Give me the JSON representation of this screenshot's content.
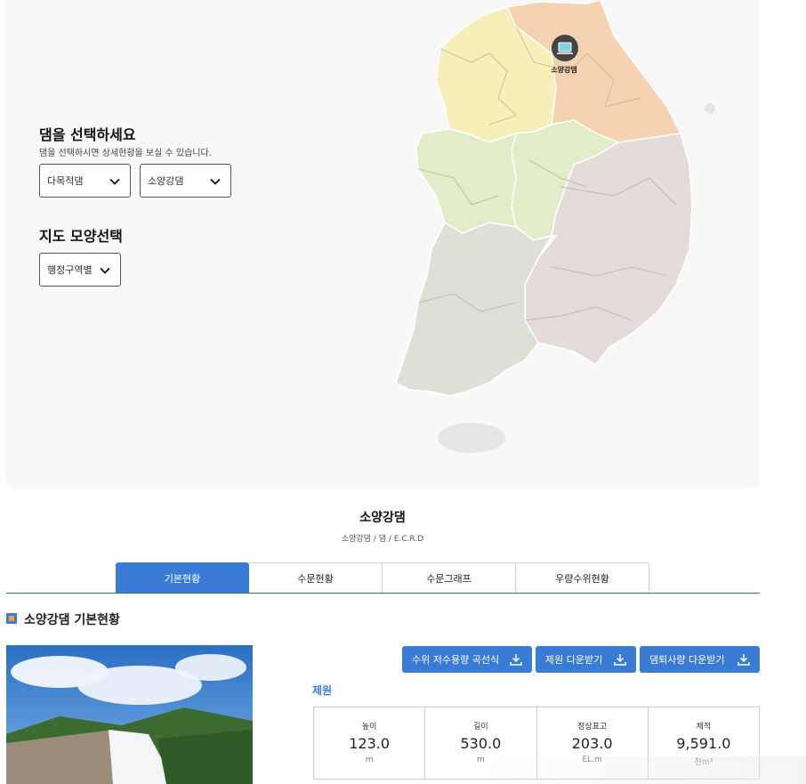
{
  "selector": {
    "title": "댐을 선택하세요",
    "subtitle": "댐을 선택하시면 상세현황을 보실 수 있습니다.",
    "dam_type": "다목적댐",
    "dam_name": "소양강댐"
  },
  "map_shape": {
    "title": "지도 모양선택",
    "value": "행정구역별"
  },
  "map": {
    "marker_label": "소양강댐",
    "region_colors": [
      "#f6efb8",
      "#f5d3b2",
      "#e1ecc9",
      "#e3dcd9",
      "#dedfd6"
    ]
  },
  "dam": {
    "title": "소양강댐",
    "crumb": "소양강댐 / 댐 / E.C.R.D"
  },
  "tabs": [
    "기본현황",
    "수문현황",
    "수문그래프",
    "우량수위현황"
  ],
  "section": {
    "title": "소양강댐 기본현황"
  },
  "buttons": {
    "curve": "수위 저수용량 곡선식",
    "spec_download": "제원 다운받기",
    "sediment_download": "댐퇴사량 다운받기"
  },
  "spec": {
    "label": "제원",
    "items": [
      {
        "name": "높이",
        "value": "123.0",
        "unit": "m"
      },
      {
        "name": "길이",
        "value": "530.0",
        "unit": "m"
      },
      {
        "name": "정상표고",
        "value": "203.0",
        "unit": "EL.m"
      },
      {
        "name": "체적",
        "value": "9,591.0",
        "unit": "천m³"
      }
    ]
  }
}
